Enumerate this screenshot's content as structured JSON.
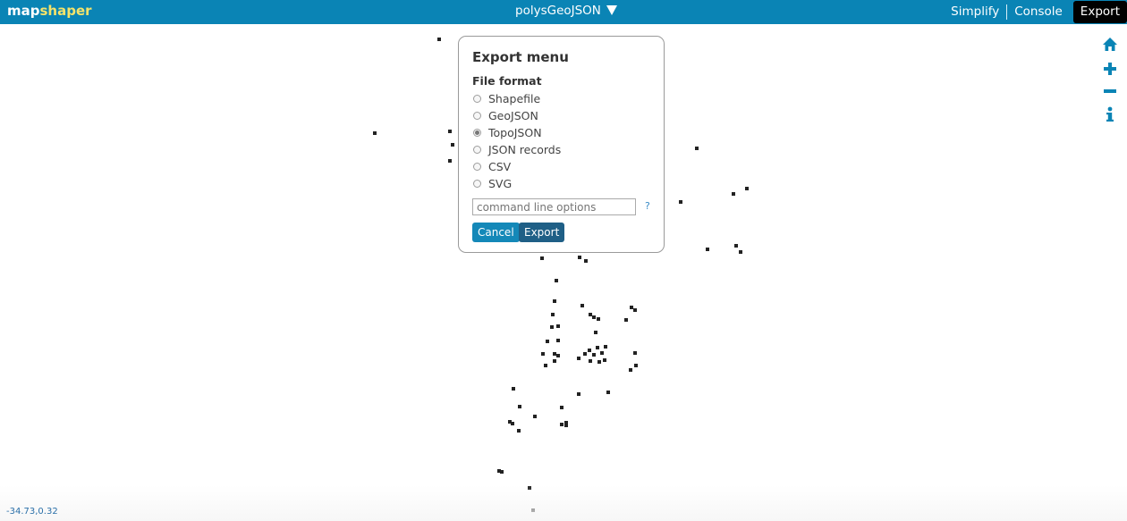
{
  "app": {
    "logo_part1": "map",
    "logo_part2": "shaper"
  },
  "header": {
    "layer_name": "polysGeoJSON",
    "nav": {
      "simplify": "Simplify",
      "console": "Console",
      "export": "Export"
    }
  },
  "colors": {
    "topbar": "#0a84b5",
    "logo_accent": "#f5e36a",
    "points": "#222222",
    "tool_icons": "#0a84b5"
  },
  "tools": [
    {
      "name": "home-icon"
    },
    {
      "name": "zoom-in-icon"
    },
    {
      "name": "zoom-out-icon"
    },
    {
      "name": "info-icon"
    }
  ],
  "export_menu": {
    "title": "Export menu",
    "format_heading": "File format",
    "formats": [
      "Shapefile",
      "GeoJSON",
      "TopoJSON",
      "JSON records",
      "CSV",
      "SVG"
    ],
    "selected_format": "TopoJSON",
    "command_placeholder": "command line options",
    "help_label": "?",
    "cancel_label": "Cancel",
    "export_label": "Export"
  },
  "status": {
    "coordinates": "-34.73,0.32"
  }
}
